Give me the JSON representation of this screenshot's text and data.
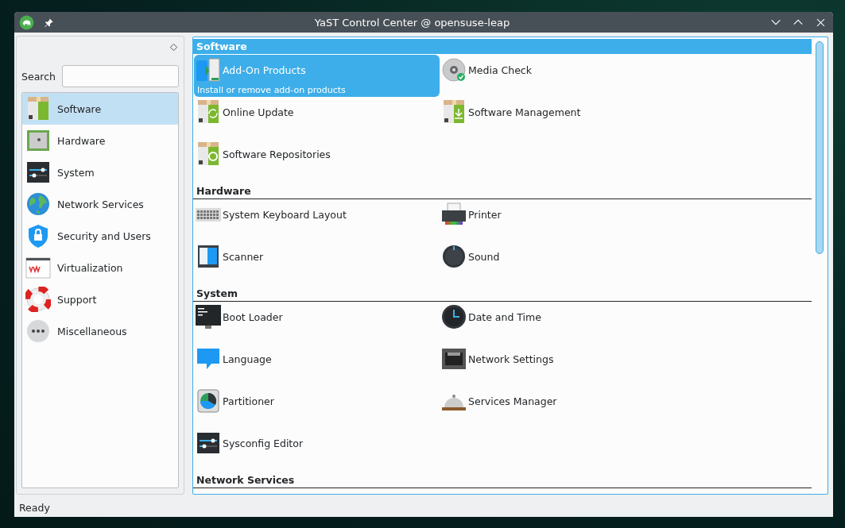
{
  "window": {
    "title": "YaST Control Center @ opensuse-leap"
  },
  "search": {
    "label": "Search"
  },
  "sidebar": {
    "items": [
      {
        "label": "Software",
        "selected": true
      },
      {
        "label": "Hardware",
        "selected": false
      },
      {
        "label": "System",
        "selected": false
      },
      {
        "label": "Network Services",
        "selected": false
      },
      {
        "label": "Security and Users",
        "selected": false
      },
      {
        "label": "Virtualization",
        "selected": false
      },
      {
        "label": "Support",
        "selected": false
      },
      {
        "label": "Miscellaneous",
        "selected": false
      }
    ]
  },
  "sections": [
    {
      "title": "Software",
      "selected": true,
      "items": [
        {
          "label": "Add-On Products",
          "selected": true,
          "description": "Install or remove add-on products"
        },
        {
          "label": "Media Check",
          "selected": false
        },
        {
          "label": "Online Update",
          "selected": false
        },
        {
          "label": "Software Management",
          "selected": false
        },
        {
          "label": "Software Repositories",
          "selected": false
        }
      ]
    },
    {
      "title": "Hardware",
      "selected": false,
      "items": [
        {
          "label": "System Keyboard Layout",
          "selected": false
        },
        {
          "label": "Printer",
          "selected": false
        },
        {
          "label": "Scanner",
          "selected": false
        },
        {
          "label": "Sound",
          "selected": false
        }
      ]
    },
    {
      "title": "System",
      "selected": false,
      "items": [
        {
          "label": "Boot Loader",
          "selected": false
        },
        {
          "label": "Date and Time",
          "selected": false
        },
        {
          "label": "Language",
          "selected": false
        },
        {
          "label": "Network Settings",
          "selected": false
        },
        {
          "label": "Partitioner",
          "selected": false
        },
        {
          "label": "Services Manager",
          "selected": false
        },
        {
          "label": "Sysconfig Editor",
          "selected": false
        }
      ]
    },
    {
      "title": "Network Services",
      "selected": false
    }
  ],
  "status_bar": {
    "text": "Ready"
  }
}
